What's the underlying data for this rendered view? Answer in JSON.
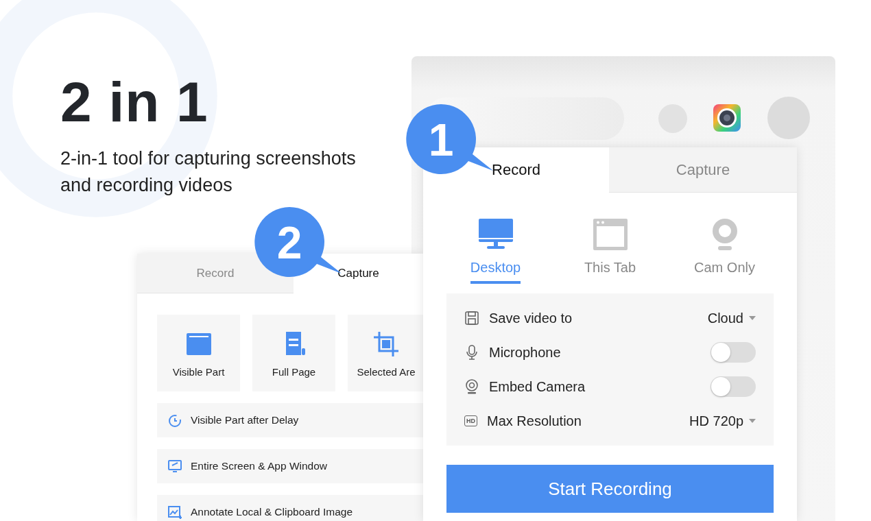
{
  "headline": "2 in 1",
  "subtitle": "2-in-1 tool for capturing screenshots and recording videos",
  "callouts": [
    "1",
    "2"
  ],
  "capture_panel": {
    "tabs": [
      {
        "label": "Record",
        "selected": false
      },
      {
        "label": "Capture",
        "selected": true
      }
    ],
    "tiles": [
      {
        "label": "Visible Part",
        "kind": "window"
      },
      {
        "label": "Full Page",
        "kind": "scroll"
      },
      {
        "label": "Selected Are",
        "kind": "crop"
      }
    ],
    "actions": [
      {
        "label": "Visible Part after Delay",
        "kind": "delay"
      },
      {
        "label": "Entire Screen & App Window",
        "kind": "screen"
      },
      {
        "label": "Annotate Local & Clipboard Image",
        "kind": "image"
      }
    ]
  },
  "record_panel": {
    "tabs": [
      {
        "label": "Record",
        "selected": true
      },
      {
        "label": "Capture",
        "selected": false
      }
    ],
    "modes": [
      {
        "label": "Desktop",
        "kind": "desktop",
        "selected": true
      },
      {
        "label": "This Tab",
        "kind": "tab",
        "selected": false
      },
      {
        "label": "Cam Only",
        "kind": "cam",
        "selected": false
      }
    ],
    "settings": [
      {
        "kind": "select",
        "label": "Save video to",
        "value": "Cloud"
      },
      {
        "kind": "toggle",
        "label": "Microphone",
        "on": false
      },
      {
        "kind": "toggle",
        "label": "Embed Camera",
        "on": false
      },
      {
        "kind": "select",
        "badge": "HD",
        "label": "Max Resolution",
        "value": "HD 720p"
      }
    ],
    "start_button": "Start Recording"
  }
}
